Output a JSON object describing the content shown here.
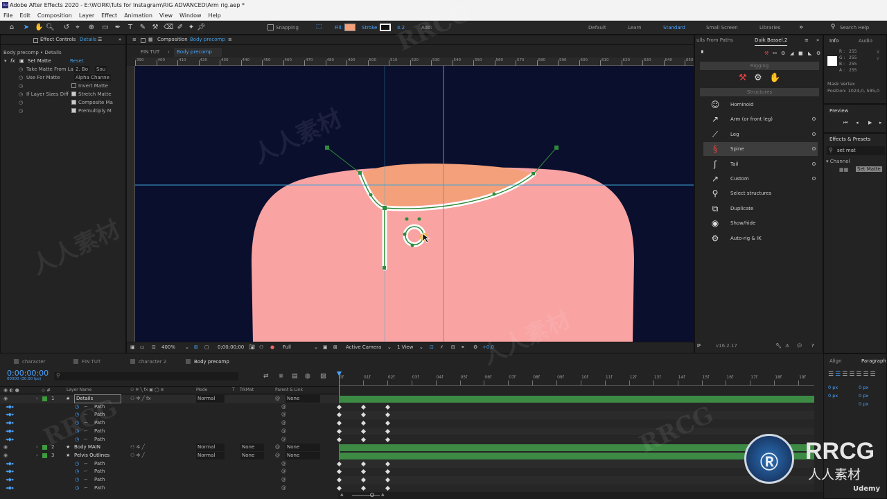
{
  "app": {
    "logo": "Ae",
    "title": "Adobe After Effects 2020 - E:\\WORK\\Tuts for Instagram\\RIG ADVANCED\\Arm rig.aep *"
  },
  "menu": [
    "File",
    "Edit",
    "Composition",
    "Layer",
    "Effect",
    "Animation",
    "View",
    "Window",
    "Help"
  ],
  "toolbar": {
    "snapping": "Snapping",
    "fill_label": "Fill:",
    "stroke_label": "Stroke",
    "stroke_px": "4.2",
    "add_label": "Add:",
    "fill_color": "#f4a07a",
    "workspaces": [
      "Default",
      "Learn",
      "Standard",
      "Small Screen",
      "Libraries"
    ],
    "search_help": "Search Help"
  },
  "effect_controls": {
    "tab": "Effect Controls",
    "tab_target": "Details",
    "header": "Body precomp • Details",
    "effect_name": "Set Matte",
    "reset": "Reset",
    "props": [
      {
        "label": "Take Matte From La",
        "value": "2. Bo",
        "value2": "Sou"
      },
      {
        "label": "Use For Matte",
        "value": "Alpha Channe"
      },
      {
        "label": "",
        "check": "Invert Matte",
        "on": false
      },
      {
        "label": "If Layer Sizes Diff",
        "check": "Stretch Matte",
        "on": true
      },
      {
        "label": "",
        "check": "Composite Ma",
        "on": true
      },
      {
        "label": "",
        "check": "Premultiply M",
        "on": true
      }
    ]
  },
  "composition": {
    "tab_prefix": "Composition",
    "tab_name": "Body precomp",
    "breadcrumb": [
      "FIN TUT",
      "Body precomp"
    ],
    "ruler": [
      "390",
      "400",
      "410",
      "420",
      "430",
      "440",
      "450",
      "460",
      "470",
      "480",
      "490",
      "500",
      "510",
      "520",
      "530",
      "540",
      "550",
      "560",
      "570",
      "580",
      "590",
      "600",
      "610",
      "620",
      "630",
      "640",
      "650"
    ],
    "zoom": "400%",
    "timecode": "0;00;00;00",
    "resolution": "Full",
    "camera": "Active Camera",
    "views": "1 View",
    "exposure": "+0.0",
    "bg_color": "#0a0f2e",
    "body_color": "#f9a3a3",
    "matte_color": "#f4a07a"
  },
  "duik": {
    "header_left": "ulls From Paths",
    "tab": "Duik Bassel.2",
    "rigging": "Rigging",
    "structures": "Structures",
    "items": [
      {
        "icon": "hominoid-icon",
        "glyph": "☺",
        "label": "Hominoid",
        "dot": false
      },
      {
        "icon": "arm-icon",
        "glyph": "↗",
        "label": "Arm (or front leg)",
        "dot": true
      },
      {
        "icon": "leg-icon",
        "glyph": "⟋",
        "label": "Leg",
        "dot": true
      },
      {
        "icon": "spine-icon",
        "glyph": "§",
        "label": "Spine",
        "dot": true,
        "active": true
      },
      {
        "icon": "tail-icon",
        "glyph": "ʃ",
        "label": "Tail",
        "dot": true
      },
      {
        "icon": "custom-icon",
        "glyph": "↗",
        "label": "Custom",
        "dot": true
      },
      {
        "icon": "select-structures-icon",
        "glyph": "⚲",
        "label": "Select structures",
        "dot": false
      },
      {
        "icon": "duplicate-icon",
        "glyph": "⧉",
        "label": "Duplicate",
        "dot": false
      },
      {
        "icon": "show-hide-icon",
        "glyph": "◉",
        "label": "Show/hide",
        "dot": false
      },
      {
        "icon": "auto-rig-icon",
        "glyph": "⚙",
        "label": "Auto-rig & IK",
        "dot": false
      }
    ],
    "version": "v16.2.17"
  },
  "info": {
    "tab": "Info",
    "tab2": "Audio",
    "rgba": [
      {
        "k": "R :",
        "v": "255"
      },
      {
        "k": "G :",
        "v": "255"
      },
      {
        "k": "B :",
        "v": "255"
      },
      {
        "k": "A :",
        "v": "255"
      }
    ],
    "mask_label": "Mask Vertex",
    "position": "Position: 1024,0, 585,0"
  },
  "preview": {
    "tab": "Preview"
  },
  "effects_presets": {
    "tab": "Effects & Presets",
    "search": "set mat",
    "category": "Channel",
    "result": "Set Matte"
  },
  "paragraph": {
    "tab1": "Align",
    "tab2": "Paragraph",
    "vals": [
      "0 px",
      "0 px",
      "0 px",
      "0 px",
      "0 px"
    ]
  },
  "timeline": {
    "tabs": [
      "character",
      "FIN TUT",
      "character 2",
      "Body precomp"
    ],
    "timecode": "0:00:00:00",
    "fps": "00000 (30.00 fps)",
    "search_placeholder": "",
    "columns": {
      "name": "Layer Name",
      "mode": "Mode",
      "t": "T",
      "trkmat": "TrkMat",
      "parent": "Parent & Link"
    },
    "ruler": [
      "0f",
      "01f",
      "02f",
      "03f",
      "04f",
      "05f",
      "06f",
      "07f",
      "08f",
      "09f",
      "10f",
      "11f",
      "12f",
      "13f",
      "14f",
      "15f",
      "16f",
      "17f",
      "18f",
      "19f"
    ],
    "layers": [
      {
        "num": "1",
        "name": "Details",
        "mode": "Normal",
        "trkmat": "",
        "parent": "None",
        "kind": "layer"
      },
      {
        "name": "Path",
        "kind": "path"
      },
      {
        "name": "Path",
        "kind": "path"
      },
      {
        "name": "Path",
        "kind": "path"
      },
      {
        "name": "Path",
        "kind": "path"
      },
      {
        "name": "Path",
        "kind": "path"
      },
      {
        "num": "2",
        "name": "Body MAIN",
        "mode": "Normal",
        "trkmat": "None",
        "parent": "None",
        "kind": "layer"
      },
      {
        "num": "3",
        "name": "Pelvis Outlines",
        "mode": "Normal",
        "trkmat": "None",
        "parent": "None",
        "kind": "layer"
      },
      {
        "name": "Path",
        "kind": "path"
      },
      {
        "name": "Path",
        "kind": "path"
      },
      {
        "name": "Path",
        "kind": "path"
      },
      {
        "name": "Path",
        "kind": "path"
      }
    ]
  },
  "watermark": {
    "brand": "RRCG",
    "sub": "人人素材",
    "udemy": "Udemy"
  }
}
